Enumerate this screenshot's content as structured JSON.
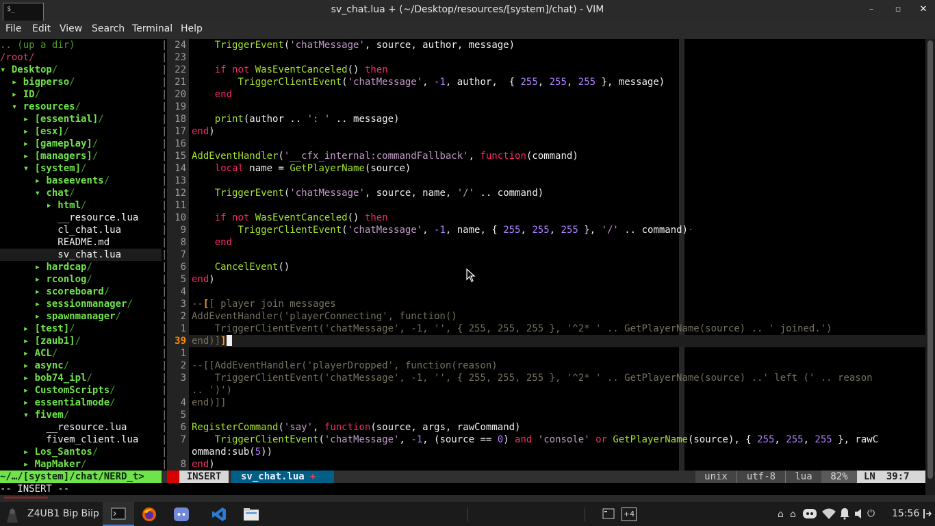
{
  "window": {
    "title": "sv_chat.lua + (~/Desktop/resources/[system]/chat) - VIM",
    "minimize_glyph": "–",
    "maximize_glyph": "▫",
    "close_glyph": "✕",
    "app_icon_label": "$_"
  },
  "menu": [
    "File",
    "Edit",
    "View",
    "Search",
    "Terminal",
    "Help"
  ],
  "tree": {
    "up": ".. (up a dir)",
    "root": "/root/",
    "rows": [
      {
        "indent": "",
        "arrow": "▾ ",
        "name": "Desktop",
        "kind": "dir"
      },
      {
        "indent": "  ",
        "arrow": "▸ ",
        "name": "bigperso",
        "kind": "dir"
      },
      {
        "indent": "  ",
        "arrow": "▸ ",
        "name": "ID",
        "kind": "dir"
      },
      {
        "indent": "  ",
        "arrow": "▾ ",
        "name": "resources",
        "kind": "dir"
      },
      {
        "indent": "    ",
        "arrow": "▸ ",
        "name": "[essential]",
        "kind": "dir"
      },
      {
        "indent": "    ",
        "arrow": "▸ ",
        "name": "[esx]",
        "kind": "dir"
      },
      {
        "indent": "    ",
        "arrow": "▸ ",
        "name": "[gameplay]",
        "kind": "dir"
      },
      {
        "indent": "    ",
        "arrow": "▸ ",
        "name": "[managers]",
        "kind": "dir"
      },
      {
        "indent": "    ",
        "arrow": "▾ ",
        "name": "[system]",
        "kind": "dir"
      },
      {
        "indent": "      ",
        "arrow": "▸ ",
        "name": "baseevents",
        "kind": "dir"
      },
      {
        "indent": "      ",
        "arrow": "▾ ",
        "name": "chat",
        "kind": "dir"
      },
      {
        "indent": "        ",
        "arrow": "▸ ",
        "name": "html",
        "kind": "dir"
      },
      {
        "indent": "          ",
        "arrow": "",
        "name": "__resource.lua",
        "kind": "file"
      },
      {
        "indent": "          ",
        "arrow": "",
        "name": "cl_chat.lua",
        "kind": "file"
      },
      {
        "indent": "          ",
        "arrow": "",
        "name": "README.md",
        "kind": "file"
      },
      {
        "indent": "          ",
        "arrow": "",
        "name": "sv_chat.lua",
        "kind": "file",
        "selected": true
      },
      {
        "indent": "      ",
        "arrow": "▸ ",
        "name": "hardcap",
        "kind": "dir"
      },
      {
        "indent": "      ",
        "arrow": "▸ ",
        "name": "rconlog",
        "kind": "dir"
      },
      {
        "indent": "      ",
        "arrow": "▸ ",
        "name": "scoreboard",
        "kind": "dir"
      },
      {
        "indent": "      ",
        "arrow": "▸ ",
        "name": "sessionmanager",
        "kind": "dir"
      },
      {
        "indent": "      ",
        "arrow": "▸ ",
        "name": "spawnmanager",
        "kind": "dir"
      },
      {
        "indent": "    ",
        "arrow": "▸ ",
        "name": "[test]",
        "kind": "dir"
      },
      {
        "indent": "    ",
        "arrow": "▸ ",
        "name": "[zaub1]",
        "kind": "dir"
      },
      {
        "indent": "    ",
        "arrow": "▸ ",
        "name": "ACL",
        "kind": "dir"
      },
      {
        "indent": "    ",
        "arrow": "▸ ",
        "name": "async",
        "kind": "dir"
      },
      {
        "indent": "    ",
        "arrow": "▸ ",
        "name": "bob74_ipl",
        "kind": "dir"
      },
      {
        "indent": "    ",
        "arrow": "▸ ",
        "name": "CustomScripts",
        "kind": "dir"
      },
      {
        "indent": "    ",
        "arrow": "▸ ",
        "name": "essentialmode",
        "kind": "dir"
      },
      {
        "indent": "    ",
        "arrow": "▾ ",
        "name": "fivem",
        "kind": "dir"
      },
      {
        "indent": "        ",
        "arrow": "",
        "name": "__resource.lua",
        "kind": "file"
      },
      {
        "indent": "        ",
        "arrow": "",
        "name": "fivem_client.lua",
        "kind": "file"
      },
      {
        "indent": "    ",
        "arrow": "▸ ",
        "name": "Los_Santos",
        "kind": "dir"
      },
      {
        "indent": "    ",
        "arrow": "▸ ",
        "name": "MapMaker",
        "kind": "dir"
      }
    ]
  },
  "code_lines": [
    {
      "num": "24",
      "html": "    <span class=\"fn\">TriggerEvent</span>(<span class=\"st\">'chatMessage'</span>, source, author, message)"
    },
    {
      "num": "23",
      "html": ""
    },
    {
      "num": "22",
      "html": "    <span class=\"kw\">if</span> <span class=\"kw\">not</span> <span class=\"fn\">WasEventCanceled</span>() <span class=\"kw\">then</span>"
    },
    {
      "num": "21",
      "html": "        <span class=\"fn\">TriggerClientEvent</span>(<span class=\"st\">'chatMessage'</span>, <span class=\"nu\">-1</span>, author,  { <span class=\"nu\">255</span>, <span class=\"nu\">255</span>, <span class=\"nu\">255</span> }, message)"
    },
    {
      "num": "20",
      "html": "    <span class=\"kw\">end</span>"
    },
    {
      "num": "19",
      "html": ""
    },
    {
      "num": "18",
      "html": "    <span class=\"fn\">print</span>(author .. <span class=\"st\">': '</span> .. message)"
    },
    {
      "num": "17",
      "html": "<span class=\"kw\">end</span>)"
    },
    {
      "num": "16",
      "html": ""
    },
    {
      "num": "15",
      "html": "<span class=\"fn\">AddEventHandler</span>(<span class=\"st\">'__cfx_internal:commandFallback'</span>, <span class=\"kw\">function</span>(command)"
    },
    {
      "num": "14",
      "html": "    <span class=\"kw\">local</span> name = <span class=\"fn\">GetPlayerName</span>(source)"
    },
    {
      "num": "13",
      "html": ""
    },
    {
      "num": "12",
      "html": "    <span class=\"fn\">TriggerEvent</span>(<span class=\"st\">'chatMessage'</span>, source, name, <span class=\"st\">'/'</span> .. command)"
    },
    {
      "num": "11",
      "html": ""
    },
    {
      "num": "10",
      "html": "    <span class=\"kw\">if</span> <span class=\"kw\">not</span> <span class=\"fn\">WasEventCanceled</span>() <span class=\"kw\">then</span>"
    },
    {
      "num": "9",
      "html": "        <span class=\"fn\">TriggerClientEvent</span>(<span class=\"st\">'chatMessage'</span>, <span class=\"nu\">-1</span>, name, { <span class=\"nu\">255</span>, <span class=\"nu\">255</span>, <span class=\"nu\">255</span> }, <span class=\"st\">'/'</span> .. command)<span class=\"cm\">·</span>"
    },
    {
      "num": "8",
      "html": "    <span class=\"kw\">end</span>"
    },
    {
      "num": "7",
      "html": ""
    },
    {
      "num": "6",
      "html": "    <span class=\"fn\">CancelEvent</span>()"
    },
    {
      "num": "5",
      "html": "<span class=\"kw\">end</span>)"
    },
    {
      "num": "4",
      "html": ""
    },
    {
      "num": "3",
      "html": "<span class=\"cm\">--</span><span class=\"br\">[</span><span class=\"cm\">[ player join messages</span>"
    },
    {
      "num": "2",
      "html": "<span class=\"cm\">AddEventHandler('playerConnecting', function()</span>"
    },
    {
      "num": "1",
      "html": "<span class=\"cm\">    TriggerClientEvent('chatMessage', -1, '', { 255, 255, 255 }, '^2* ' .. GetPlayerName(source) .. ' joined.')</span>"
    },
    {
      "num": "39",
      "cur": true,
      "html": "<span class=\"cm\">end)]</span><span class=\"br\">]</span><span class=\"cursor\"></span>"
    },
    {
      "num": "1",
      "html": ""
    },
    {
      "num": "2",
      "html": "<span class=\"cm\">--[[AddEventHandler('playerDropped', function(reason)</span>"
    },
    {
      "num": "3",
      "html": "<span class=\"cm\">    TriggerClientEvent('chatMessage', -1, '', { 255, 255, 255 }, '^2* ' .. GetPlayerName(source) ..' left (' .. reason</span>"
    },
    {
      "num": "",
      "html": "<span class=\"cm\">.. ')')</span>"
    },
    {
      "num": "4",
      "html": "<span class=\"cm\">end)]]</span>"
    },
    {
      "num": "5",
      "html": ""
    },
    {
      "num": "6",
      "html": "<span class=\"fn\">RegisterCommand</span>(<span class=\"st\">'say'</span>, <span class=\"kw\">function</span>(source, args, rawCommand)"
    },
    {
      "num": "7",
      "html": "    <span class=\"fn\">TriggerClientEvent</span>(<span class=\"st\">'chatMessage'</span>, <span class=\"nu\">-1</span>, (source == <span class=\"nu\">0</span>) <span class=\"kw\">and</span> <span class=\"st\">'console'</span> <span class=\"kw\">or</span> <span class=\"fn\">GetPlayerName</span>(source), { <span class=\"nu\">255</span>, <span class=\"nu\">255</span>, <span class=\"nu\">255</span> }, rawC"
    },
    {
      "num": "",
      "html": "ommand:sub(<span class=\"nu\">5</span>))"
    },
    {
      "num": "8",
      "html": "<span class=\"kw\">end</span>)"
    }
  ],
  "statusline": {
    "tree_path": "~/…/[system]/chat/NERD_t>",
    "mode": "INSERT",
    "file": "sv_chat.lua",
    "modified": "+",
    "fileformat": "unix",
    "encoding": "utf-8",
    "filetype": "lua",
    "percent": "82%",
    "ln_label": "LN",
    "position": "39:7"
  },
  "cmdline": "-- INSERT --",
  "taskbar": {
    "user": "Z4UB1 Bip Biip",
    "workspace_badge": "+4",
    "clock": "15:56"
  },
  "colors": {
    "accent_green": "#6fe34a",
    "mode_bg": "#d7d7d7",
    "file_tab_bg": "#005f87",
    "line_nr_current": "#ff8c00",
    "statusline_right_bg": "#444444"
  }
}
